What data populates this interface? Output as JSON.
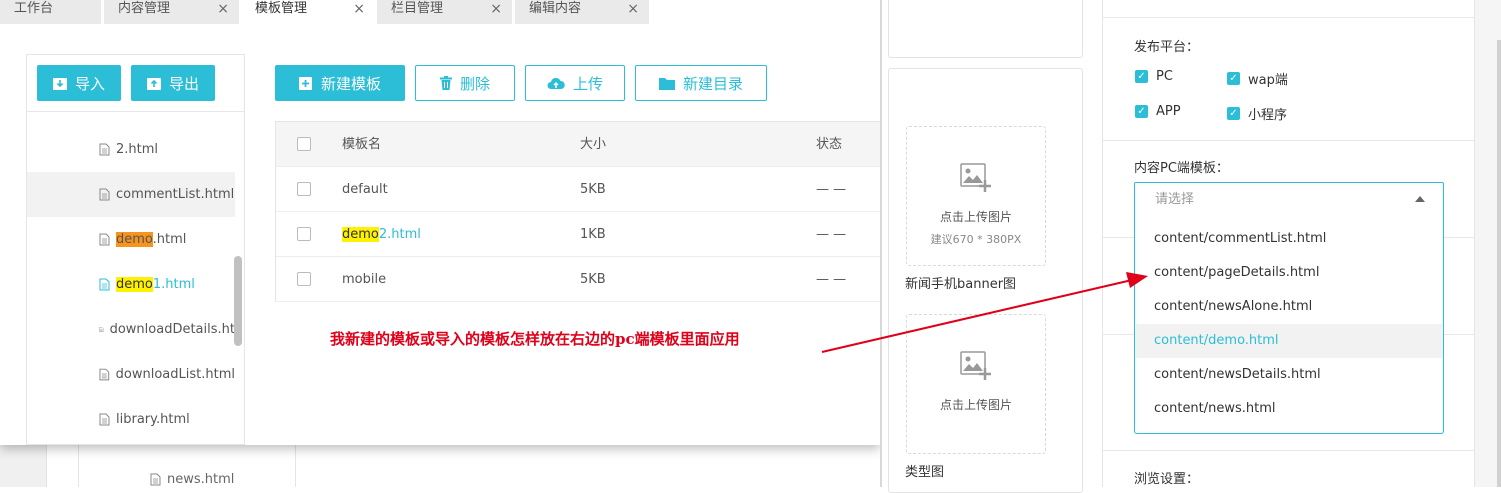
{
  "tabs": [
    {
      "label": "工作台",
      "closable": false
    },
    {
      "label": "内容管理",
      "closable": true
    },
    {
      "label": "模板管理",
      "closable": true,
      "active": true
    },
    {
      "label": "栏目管理",
      "closable": true
    },
    {
      "label": "编辑内容",
      "closable": true
    }
  ],
  "tab_close_glyph": "×",
  "file_panel": {
    "import_label": "导入",
    "export_label": "导出",
    "files": [
      {
        "pre": "",
        "hl": "",
        "post": "2.html"
      },
      {
        "pre": "",
        "hl": "",
        "post": "commentList.html",
        "selected": true
      },
      {
        "pre": "",
        "hl": "demo",
        "post": ".html",
        "hl_color": "orange"
      },
      {
        "pre": "",
        "hl": "demo",
        "post": "1.html",
        "teal": true
      },
      {
        "pre": "",
        "hl": "",
        "post": "downloadDetails.ht"
      },
      {
        "pre": "",
        "hl": "",
        "post": "downloadList.html"
      },
      {
        "pre": "",
        "hl": "",
        "post": "library.html"
      }
    ],
    "background_file": "news.html"
  },
  "toolbar": {
    "new_template": "新建模板",
    "delete": "删除",
    "upload": "上传",
    "new_dir": "新建目录"
  },
  "table": {
    "headers": {
      "name": "模板名",
      "size": "大小",
      "status": "状态"
    },
    "rows": [
      {
        "pre": "",
        "hl": "",
        "post": "default",
        "size": "5KB",
        "status": "— —"
      },
      {
        "pre": "",
        "hl": "demo",
        "post": "2.html",
        "size": "1KB",
        "status": "— —",
        "teal": true
      },
      {
        "pre": "",
        "hl": "",
        "post": "mobile",
        "size": "5KB",
        "status": "— —"
      }
    ]
  },
  "annotation": "我新建的模板或导入的模板怎样放在右边的pc端模板里面应用",
  "middle": {
    "upload_text": "点击上传图片",
    "upload_hint": "建议670 * 380PX",
    "banner_label": "新闻手机banner图",
    "upload_text2": "点击上传图片",
    "type_label": "类型图"
  },
  "right": {
    "platform_label": "发布平台：",
    "platforms": [
      "PC",
      "wap端",
      "APP",
      "小程序"
    ],
    "check_glyph": "✓",
    "pc_template_label": "内容PC端模板：",
    "select_placeholder": "请选择",
    "options": [
      "content/commentList.html",
      "content/pageDetails.html",
      "content/newsAlone.html",
      "content/demo.html",
      "content/newsDetails.html",
      "content/news.html"
    ],
    "selected_option_index": 3,
    "browse_label": "浏览设置："
  },
  "colors": {
    "accent": "#2bbed6",
    "annotation": "#e0001a",
    "highlight": "#fff200",
    "highlight_orange": "#f7941d"
  }
}
